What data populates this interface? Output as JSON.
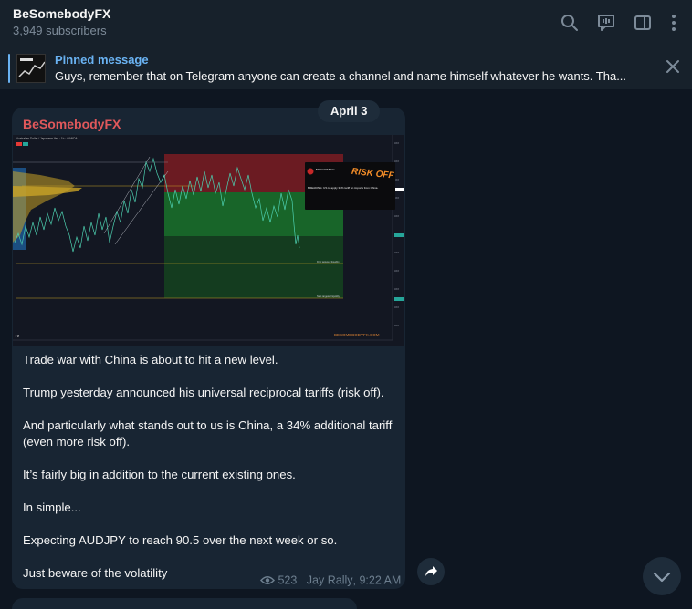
{
  "header": {
    "title": "BeSomebodyFX",
    "subtitle": "3,949 subscribers",
    "icons": [
      "search-icon",
      "discussion-icon",
      "sidebar-toggle-icon",
      "more-icon"
    ]
  },
  "pinned": {
    "title": "Pinned message",
    "text": "Guys, remember that on Telegram anyone can create a channel and name himself whatever he wants.  Tha..."
  },
  "date_separator": "April 3",
  "message": {
    "sender": "BeSomebodyFX",
    "sender_color": "#e0585b",
    "image": {
      "chart_title": "Australian Dollar / Japanese Yen · 1h · OANDA",
      "watermark": "BESOMEBODYFX.COM",
      "tweet_handle": "FinancialJuice",
      "tweet_text": "BREAKING: US to apply 34% tariff on imports from China.",
      "risk_label": "RISK OFF",
      "target1_label": "First targeted liquidity",
      "target2_label": "Next targeted liquidity"
    },
    "paragraphs": [
      "Trade war with China is about to hit a new level.",
      "Trump yesterday announced his universal reciprocal tariffs (risk off).",
      "And particularly what stands out to us is China, a 34% additional tariff (even more risk off).",
      "It’s fairly big in addition to the current existing ones.",
      "In simple...",
      "Expecting AUDJPY to reach 90.5 over the next week or so.",
      "Just beware of the volatility"
    ],
    "views": "523",
    "author": "Jay Rally",
    "time": "9:22 AM"
  },
  "colors": {
    "background": "#0e1621",
    "panel": "#17212b",
    "bubble": "#182533",
    "accent": "#6ab3f3"
  }
}
